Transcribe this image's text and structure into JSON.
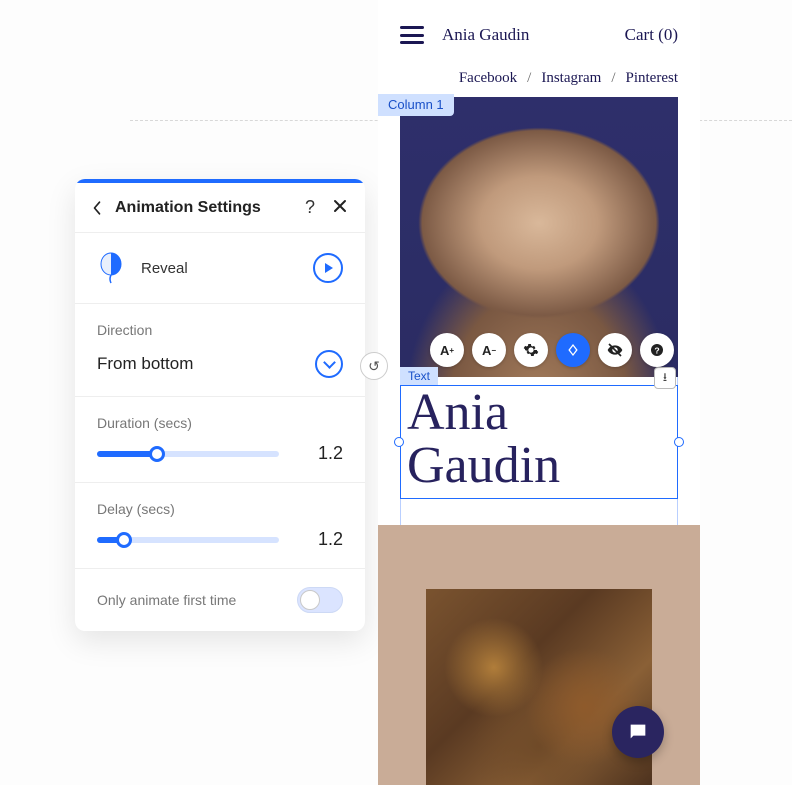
{
  "panel": {
    "title": "Animation Settings",
    "type_label": "Reveal",
    "direction_label": "Direction",
    "direction_value": "From bottom",
    "duration_label": "Duration (secs)",
    "duration_value": "1.2",
    "duration_pct": 33,
    "delay_label": "Delay (secs)",
    "delay_value": "1.2",
    "delay_pct": 15,
    "once_label": "Only animate first time"
  },
  "preview": {
    "brand": "Ania Gaudin",
    "cart": "Cart (0)",
    "social1": "Facebook",
    "social2": "Instagram",
    "social3": "Pinterest",
    "column_tag": "Column 1",
    "text_tag": "Text",
    "headline": "Ania Gaudin"
  }
}
